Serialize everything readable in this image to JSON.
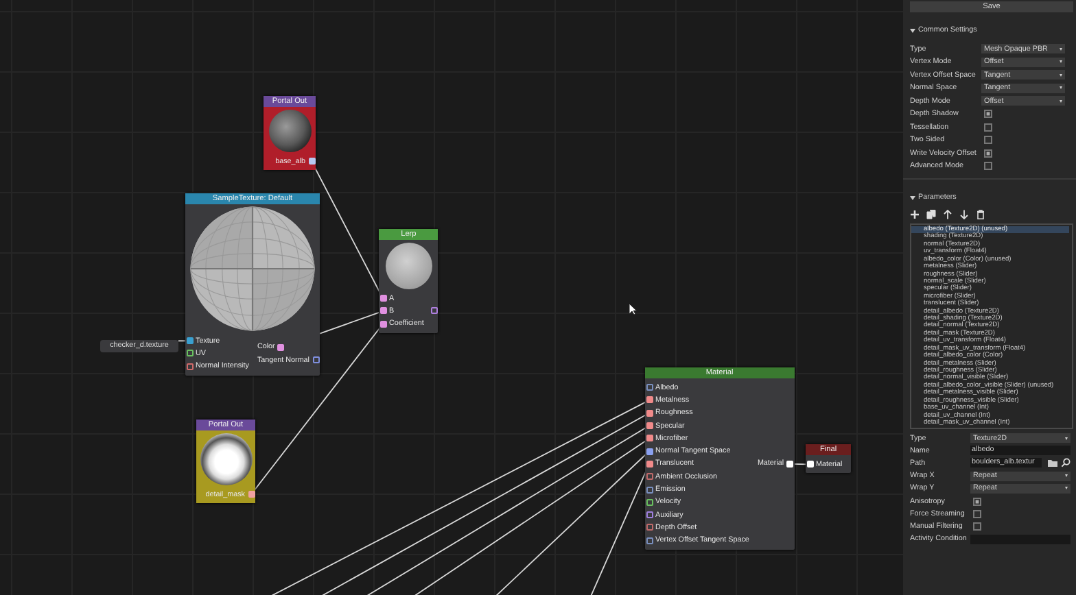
{
  "canvas": {
    "texture_value": "checker_d.texture",
    "nodes": [
      {
        "title": "Portal Out",
        "color": "#6a4a9a",
        "body": {
          "color": "#b01e2a"
        },
        "preview": {
          "kind": "rock"
        },
        "outputs": [
          {
            "label": "base_alb",
            "color": "#b8c8f0",
            "connected": true
          }
        ]
      },
      {
        "title": "SampleTexture: Default",
        "color": "#2a86ad",
        "preview": {
          "kind": "checker"
        },
        "inputs": [
          {
            "label": "Texture",
            "color": "#3aa0d0",
            "connected": true
          },
          {
            "label": "UV",
            "color": "#6ac060",
            "connected": false
          },
          {
            "label": "Normal Intensity",
            "color": "#d06a6a",
            "connected": false
          }
        ],
        "outputs": [
          {
            "label": "Color",
            "color": "#e090e0",
            "connected": true
          },
          {
            "label": "Tangent Normal",
            "color": "#8090e0",
            "connected": false
          }
        ]
      },
      {
        "title": "Lerp",
        "color": "#4a9a40",
        "preview": {
          "kind": "blend"
        },
        "inputs": [
          {
            "label": "A",
            "color": "#e090e0",
            "connected": true
          },
          {
            "label": "B",
            "color": "#e090e0",
            "connected": true
          },
          {
            "label": "Coefficient",
            "color": "#e090e0",
            "connected": true
          }
        ],
        "outputs": [
          {
            "color": "#b080e0",
            "connected": false
          }
        ]
      },
      {
        "title": "Portal Out",
        "color": "#6a4a9a",
        "body": {
          "color": "#a89a20"
        },
        "preview": {
          "kind": "cloud"
        },
        "outputs": [
          {
            "label": "detail_mask",
            "color": "#f0a0a0",
            "connected": true
          }
        ]
      },
      {
        "title": "Material",
        "color": "#3a7a30",
        "inputs": [
          {
            "label": "Albedo",
            "color": "#7a90c0",
            "connected": false
          },
          {
            "label": "Metalness",
            "color": "#f08a8a",
            "connected": true
          },
          {
            "label": "Roughness",
            "color": "#f08a8a",
            "connected": true
          },
          {
            "label": "Specular",
            "color": "#f08a8a",
            "connected": true
          },
          {
            "label": "Microfiber",
            "color": "#f08a8a",
            "connected": true
          },
          {
            "label": "Normal Tangent Space",
            "color": "#8aa0f0",
            "connected": true
          },
          {
            "label": "Translucent",
            "color": "#f08a8a",
            "connected": true
          },
          {
            "label": "Ambient Occlusion",
            "color": "#c06a6a",
            "connected": false
          },
          {
            "label": "Emission",
            "color": "#7a90c0",
            "connected": false
          },
          {
            "label": "Velocity",
            "color": "#6ac060",
            "connected": false
          },
          {
            "label": "Auxiliary",
            "color": "#a080e0",
            "connected": false
          },
          {
            "label": "Depth Offset",
            "color": "#c06a6a",
            "connected": false
          },
          {
            "label": "Vertex Offset Tangent Space",
            "color": "#7a90c0",
            "connected": false
          }
        ],
        "outputs": [
          {
            "label": "Material",
            "color": "#ffffff",
            "connected": true
          }
        ]
      },
      {
        "title": "Final",
        "color": "#6a1e1e",
        "inputs": [
          {
            "label": "Material",
            "color": "#ffffff",
            "connected": true
          }
        ]
      }
    ]
  },
  "panel": {
    "save_button": "Save",
    "common_settings": {
      "title": "Common Settings",
      "expanded": true,
      "rows": [
        {
          "kind": "dropdown",
          "label": "Type",
          "value": "Mesh Opaque PBR"
        },
        {
          "kind": "dropdown",
          "label": "Vertex Mode",
          "value": "Offset"
        },
        {
          "kind": "dropdown",
          "label": "Vertex Offset Space",
          "value": "Tangent"
        },
        {
          "kind": "dropdown",
          "label": "Normal Space",
          "value": "Tangent"
        },
        {
          "kind": "dropdown",
          "label": "Depth Mode",
          "value": "Offset"
        },
        {
          "kind": "checkbox",
          "label": "Depth Shadow",
          "checked": true
        },
        {
          "kind": "checkbox",
          "label": "Tessellation",
          "checked": false
        },
        {
          "kind": "checkbox",
          "label": "Two Sided",
          "checked": false
        },
        {
          "kind": "checkbox",
          "label": "Write Velocity Offset",
          "checked": true
        },
        {
          "kind": "checkbox",
          "label": "Advanced Mode",
          "checked": false
        }
      ]
    },
    "parameters": {
      "title": "Parameters",
      "expanded": true,
      "items": [
        {
          "label": "albedo (Texture2D) (unused)",
          "selected": true
        },
        {
          "label": "shading (Texture2D)",
          "selected": false
        },
        {
          "label": "normal (Texture2D)",
          "selected": false
        },
        {
          "label": "uv_transform (Float4)",
          "selected": false
        },
        {
          "label": "albedo_color (Color) (unused)",
          "selected": false
        },
        {
          "label": "metalness (Slider)",
          "selected": false
        },
        {
          "label": "roughness (Slider)",
          "selected": false
        },
        {
          "label": "normal_scale (Slider)",
          "selected": false
        },
        {
          "label": "specular (Slider)",
          "selected": false
        },
        {
          "label": "microfiber (Slider)",
          "selected": false
        },
        {
          "label": "translucent (Slider)",
          "selected": false
        },
        {
          "label": "detail_albedo (Texture2D)",
          "selected": false
        },
        {
          "label": "detail_shading (Texture2D)",
          "selected": false
        },
        {
          "label": "detail_normal (Texture2D)",
          "selected": false
        },
        {
          "label": "detail_mask (Texture2D)",
          "selected": false
        },
        {
          "label": "detail_uv_transform (Float4)",
          "selected": false
        },
        {
          "label": "detail_mask_uv_transform (Float4)",
          "selected": false
        },
        {
          "label": "detail_albedo_color (Color)",
          "selected": false
        },
        {
          "label": "detail_metalness (Slider)",
          "selected": false
        },
        {
          "label": "detail_roughness (Slider)",
          "selected": false
        },
        {
          "label": "detail_normal_visible (Slider)",
          "selected": false
        },
        {
          "label": "detail_albedo_color_visible (Slider) (unused)",
          "selected": false
        },
        {
          "label": "detail_metalness_visible (Slider)",
          "selected": false
        },
        {
          "label": "detail_roughness_visible (Slider)",
          "selected": false
        },
        {
          "label": "base_uv_channel (Int)",
          "selected": false
        },
        {
          "label": "detail_uv_channel (Int)",
          "selected": false
        },
        {
          "label": "detail_mask_uv_channel (Int)",
          "selected": false
        }
      ]
    },
    "properties": [
      {
        "kind": "dropdown",
        "label": "Type",
        "value": "Texture2D"
      },
      {
        "kind": "text",
        "label": "Name",
        "value": "albedo"
      },
      {
        "kind": "path",
        "label": "Path",
        "value": "boulders_alb.textur"
      },
      {
        "kind": "dropdown",
        "label": "Wrap X",
        "value": "Repeat"
      },
      {
        "kind": "dropdown",
        "label": "Wrap Y",
        "value": "Repeat"
      },
      {
        "kind": "checkbox",
        "label": "Anisotropy",
        "checked": true
      },
      {
        "kind": "checkbox",
        "label": "Force Streaming",
        "checked": false
      },
      {
        "kind": "checkbox",
        "label": "Manual Filtering",
        "checked": false
      },
      {
        "kind": "text",
        "label": "Activity Condition"
      }
    ]
  }
}
